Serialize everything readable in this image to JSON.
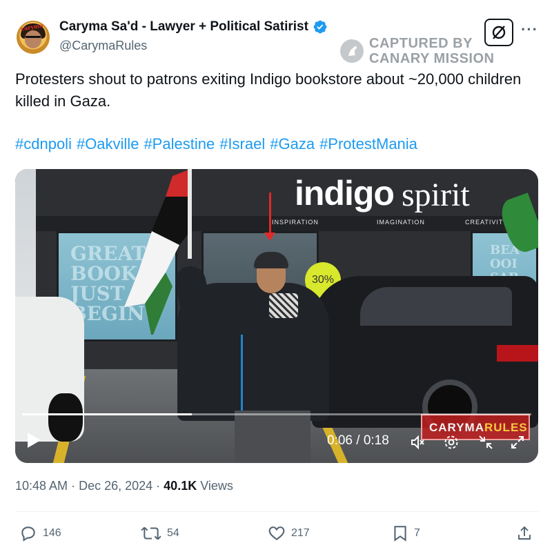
{
  "author": {
    "name": "Caryma Sa'd - Lawyer + Political Satirist",
    "handle": "@CarymaRules",
    "avatar_text": "caryma"
  },
  "watermark": {
    "line1": "CAPTURED BY",
    "line2": "CANARY MISSION"
  },
  "tweet": {
    "text": "Protesters shout to patrons exiting Indigo bookstore about ~20,000 children killed in Gaza.",
    "hashtags": [
      "#cdnpoli",
      "#Oakville",
      "#Palestine",
      "#Israel",
      "#Gaza",
      "#ProtestMania"
    ]
  },
  "video": {
    "store_sign_a": "indigo",
    "store_sign_b": "spirit",
    "lintel_words": [
      "INSPIRATION",
      "IMAGINATION",
      "CREATIVITY"
    ],
    "window_text": "GREAT BOOK JUST BEGIN",
    "window_text_right": "BEA OOI SAR",
    "sticker_text": "30%",
    "channel_logo_a": "CARYMA",
    "channel_logo_b": "RULES",
    "timecode": "0:06 / 0:18",
    "progress": 0.333,
    "colors": {
      "logo_a": "#f2f2f2",
      "logo_b": "#f7c940"
    }
  },
  "meta": {
    "time": "10:48 AM",
    "date": "Dec 26, 2024",
    "views_count": "40.1K",
    "views_label": "Views"
  },
  "actions": {
    "replies": "146",
    "reposts": "54",
    "likes": "217",
    "bookmarks": "7"
  },
  "colors": {
    "link": "#1d9bf0",
    "secondary": "#536471",
    "verified": "#1d9bf0"
  },
  "icons": [
    "verified-badge-icon",
    "grok-icon",
    "more-icon",
    "play-icon",
    "volume-icon",
    "settings-icon",
    "minimize-icon",
    "fullscreen-icon",
    "reply-icon",
    "repost-icon",
    "like-icon",
    "bookmark-icon",
    "share-icon"
  ]
}
